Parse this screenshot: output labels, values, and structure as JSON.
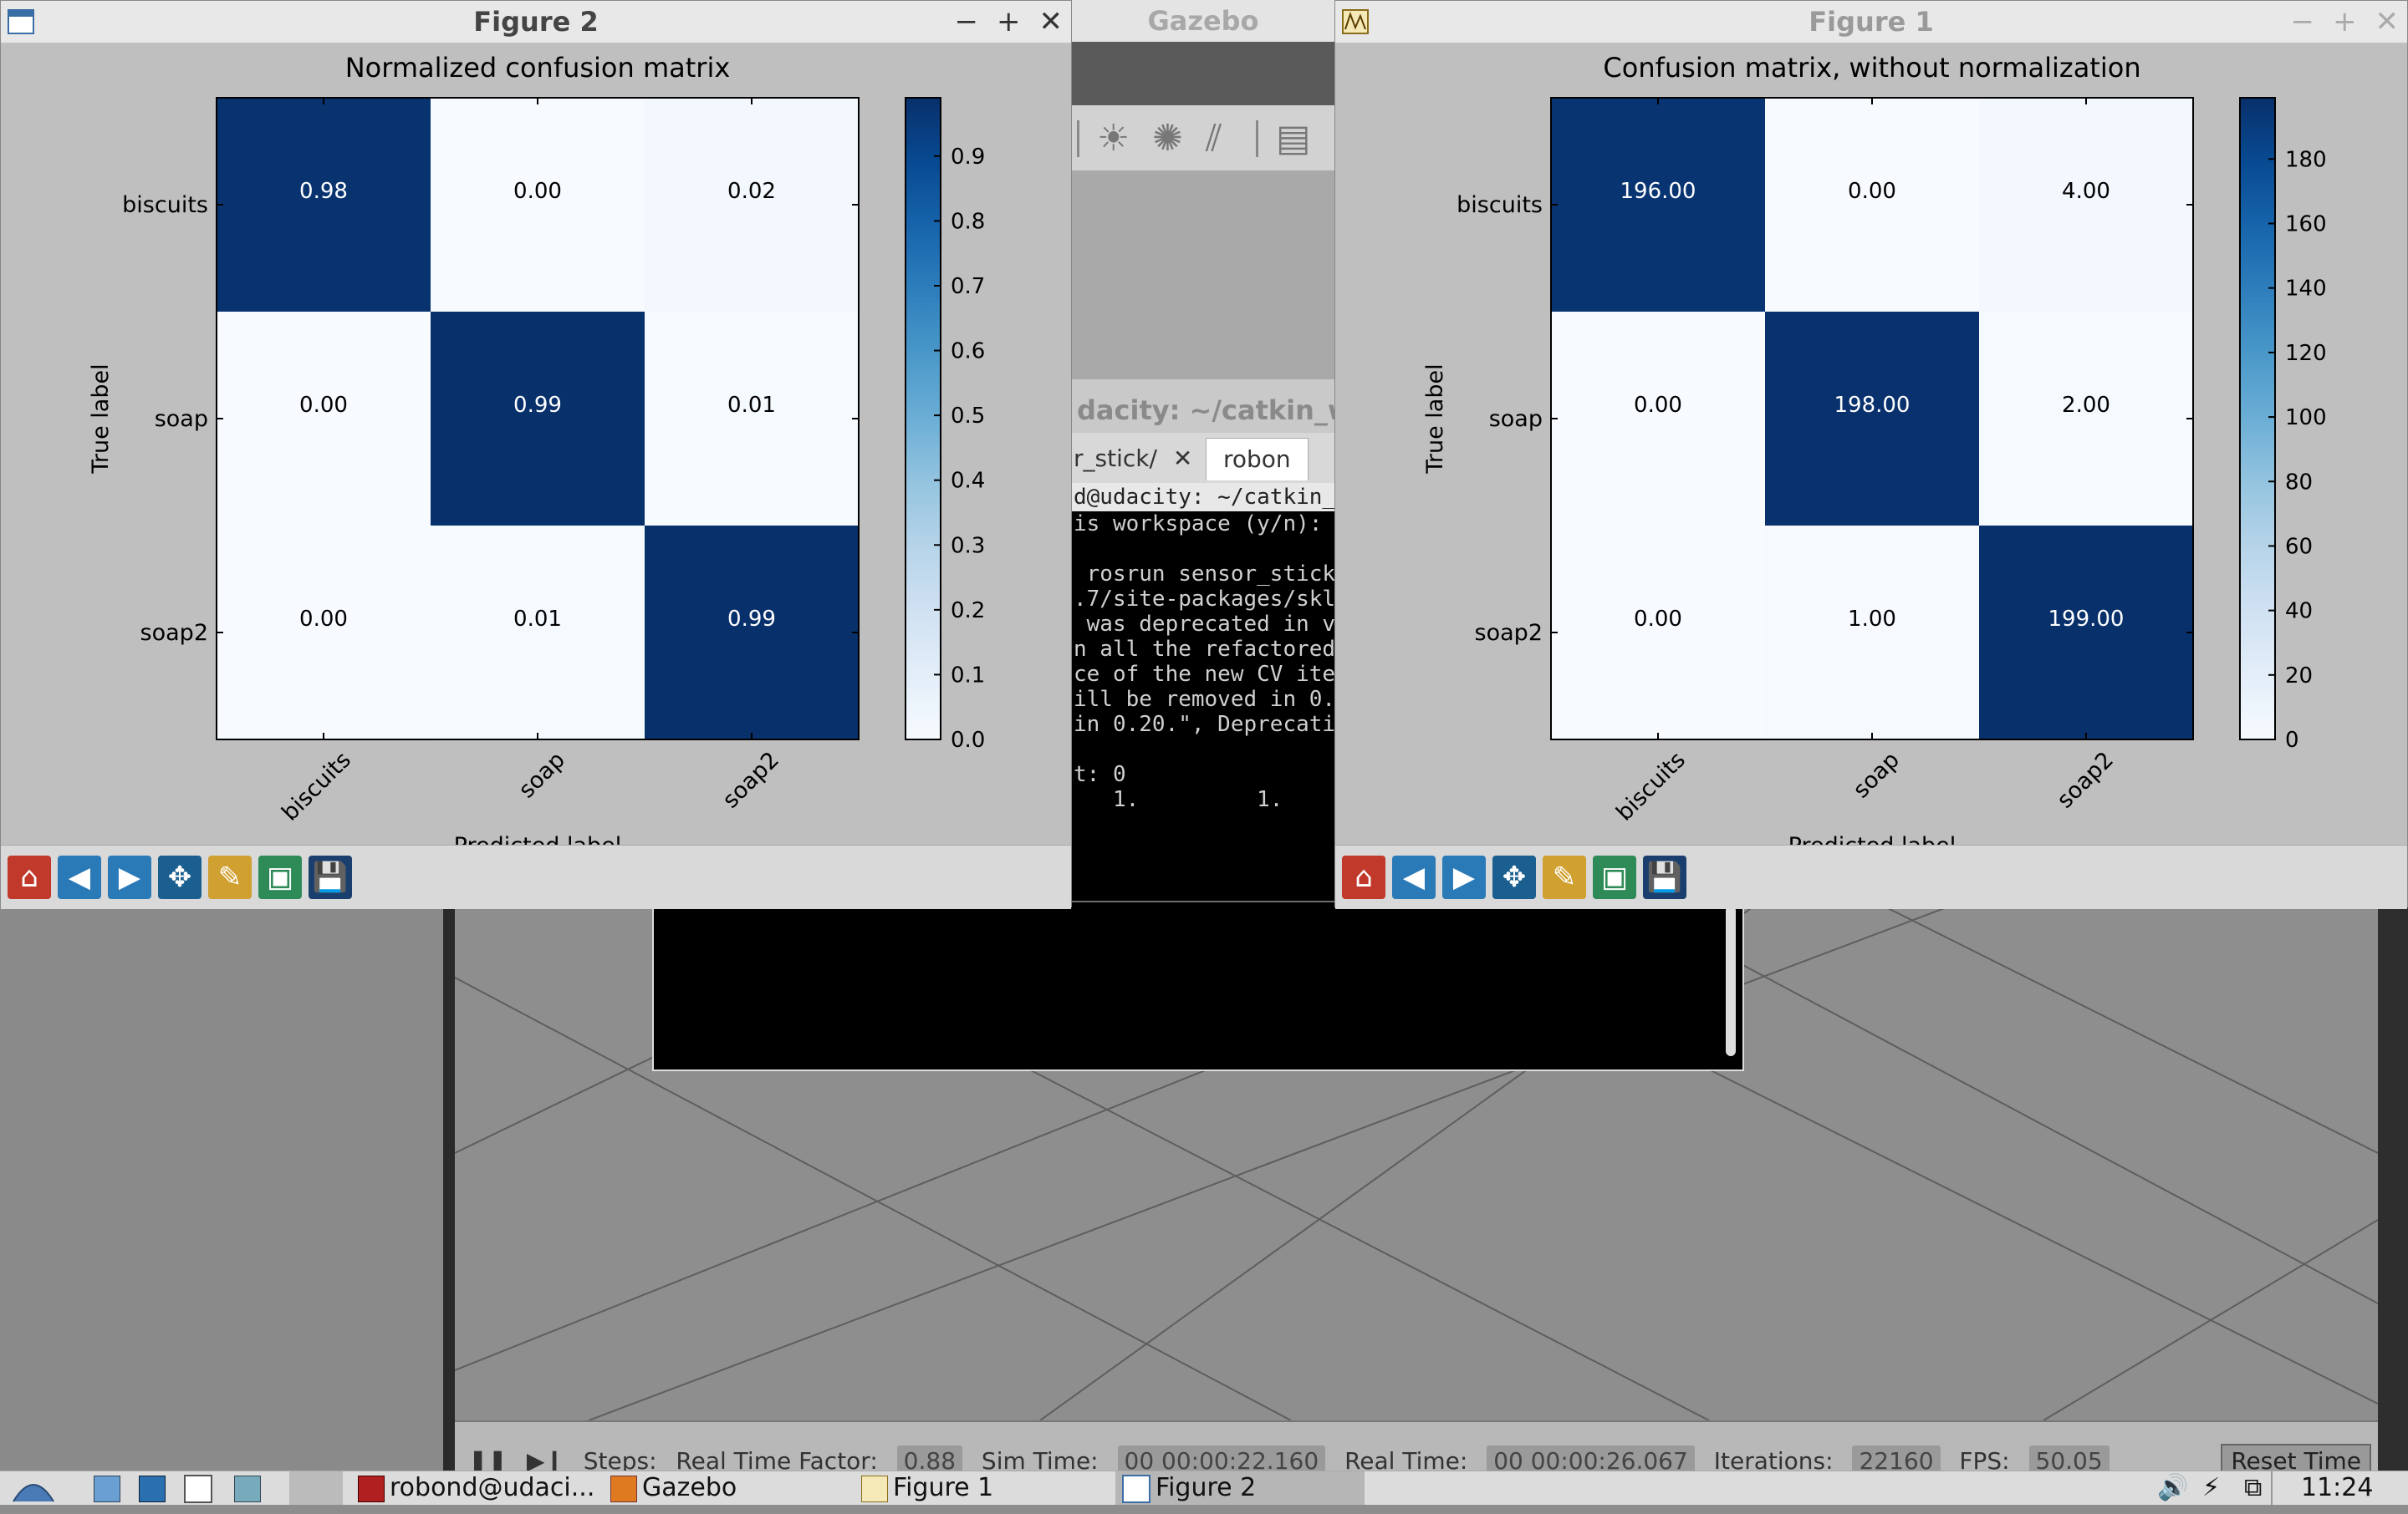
{
  "gazebo": {
    "title": "Gazebo",
    "bottom_bar": {
      "steps_label": "Steps:",
      "rtf_label": "Real Time Factor:",
      "rtf_value": "0.88",
      "sim_time_label": "Sim Time:",
      "sim_time_value": "00 00:00:22.160",
      "real_time_label": "Real Time:",
      "real_time_value": "00 00:00:26.067",
      "iterations_label": "Iterations:",
      "iterations_value": "22160",
      "fps_label": "FPS:",
      "fps_value": "50.05",
      "reset_label": "Reset Time"
    }
  },
  "terminal": {
    "title": "dacity: ~/catkin_w",
    "tab1_label": "r_stick/",
    "tab2_label": "robon",
    "prompt": "d@udacity: ~/catkin_ws/",
    "lines": [
      "is workspace (y/n):",
      "",
      " rosrun sensor_stick",
      ".7/site-packages/skl",
      " was deprecated in v",
      "n all the refactored",
      "ce of the new CV ite",
      "ill be removed in 0.",
      "in 0.20.\", Deprecati",
      "",
      "t: 0",
      "   1.         1."
    ]
  },
  "figure2": {
    "window_title": "Figure 2",
    "chart_data": {
      "type": "heatmap",
      "title": "Normalized confusion matrix",
      "xlabel": "Predicted label",
      "ylabel": "True label",
      "x_categories": [
        "biscuits",
        "soap",
        "soap2"
      ],
      "y_categories": [
        "biscuits",
        "soap",
        "soap2"
      ],
      "values": [
        [
          0.98,
          0.0,
          0.02
        ],
        [
          0.0,
          0.99,
          0.01
        ],
        [
          0.0,
          0.01,
          0.99
        ]
      ],
      "cell_labels": [
        [
          "0.98",
          "0.00",
          "0.02"
        ],
        [
          "0.00",
          "0.99",
          "0.01"
        ],
        [
          "0.00",
          "0.01",
          "0.99"
        ]
      ],
      "colorscale": "Blues",
      "vmin": 0,
      "vmax": 0.99,
      "colorbar_ticks": [
        "0.0",
        "0.1",
        "0.2",
        "0.3",
        "0.4",
        "0.5",
        "0.6",
        "0.7",
        "0.8",
        "0.9"
      ],
      "colorbar_tick_values": [
        0,
        0.1,
        0.2,
        0.3,
        0.4,
        0.5,
        0.6,
        0.7,
        0.8,
        0.9
      ]
    }
  },
  "figure1": {
    "window_title": "Figure 1",
    "chart_data": {
      "type": "heatmap",
      "title": "Confusion matrix, without normalization",
      "xlabel": "Predicted label",
      "ylabel": "True label",
      "x_categories": [
        "biscuits",
        "soap",
        "soap2"
      ],
      "y_categories": [
        "biscuits",
        "soap",
        "soap2"
      ],
      "values": [
        [
          196,
          0,
          4
        ],
        [
          0,
          198,
          2
        ],
        [
          0,
          1,
          199
        ]
      ],
      "cell_labels": [
        [
          "196.00",
          "0.00",
          "4.00"
        ],
        [
          "0.00",
          "198.00",
          "2.00"
        ],
        [
          "0.00",
          "1.00",
          "199.00"
        ]
      ],
      "colorscale": "Blues",
      "vmin": 0,
      "vmax": 199,
      "colorbar_ticks": [
        "0",
        "20",
        "40",
        "60",
        "80",
        "100",
        "120",
        "140",
        "160",
        "180"
      ],
      "colorbar_tick_values": [
        0,
        20,
        40,
        60,
        80,
        100,
        120,
        140,
        160,
        180
      ]
    }
  },
  "toolbar_icons": [
    "home-icon",
    "back-icon",
    "forward-icon",
    "pan-icon",
    "subplots-icon",
    "zoom-icon",
    "save-icon"
  ],
  "taskbar": {
    "items": [
      "robond@udaci...",
      "Gazebo",
      "Figure 1",
      "Figure 2"
    ],
    "clock": "11:24"
  }
}
